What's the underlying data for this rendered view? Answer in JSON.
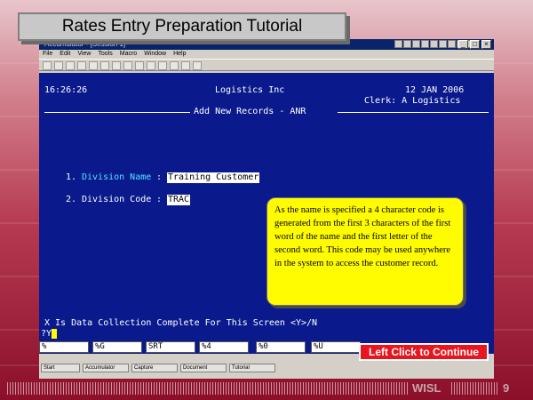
{
  "tutorial": {
    "title": "Rates Entry Preparation Tutorial",
    "footer_brand": "WISL",
    "page_number": "9"
  },
  "window": {
    "title": "Accumulator - [Session 1]",
    "menu": [
      "File",
      "Edit",
      "View",
      "Tools",
      "Macro",
      "Window",
      "Help"
    ]
  },
  "terminal": {
    "time": "16:26:26",
    "company": "Logistics Inc",
    "date": "12 JAN 2006",
    "clerk": "Clerk: A Logistics",
    "screen_title": "Add New Records - ANR",
    "fields": [
      {
        "number": "1.",
        "label": "Division Name",
        "colon": ":",
        "value": "Training Customer"
      },
      {
        "number": "2.",
        "label": "Division Code",
        "colon": ":",
        "value": "TRAC"
      }
    ],
    "prompt": "X Is Data Collection Complete For This Screen <Y>/N",
    "prompt_marker": "?Y",
    "input_value": "Y"
  },
  "callout": {
    "text": "As the name is specified a 4 character code is generated from the first 3 characters of the first word of the name and the first letter of the second word. This code may be used anywhere in the system to access the customer record."
  },
  "function_keys": [
    {
      "label": "%",
      "name": "fkey-1"
    },
    {
      "label": "%G",
      "name": "fkey-2"
    },
    {
      "label": "SRT",
      "name": "fkey-3"
    },
    {
      "label": "%4",
      "name": "fkey-4"
    },
    {
      "label": "%0",
      "name": "fkey-5"
    },
    {
      "label": "%U",
      "name": "fkey-6"
    }
  ],
  "taskbar": [
    "Start",
    "Accumulator",
    "Capture",
    "Document",
    "Tutorial"
  ],
  "continue_button": {
    "label": "Left Click to Continue"
  }
}
